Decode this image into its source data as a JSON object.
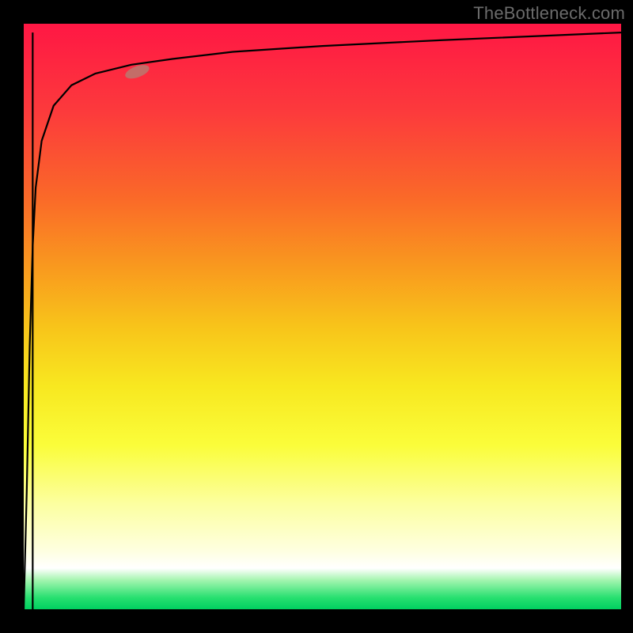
{
  "watermark": "TheBottleneck.com",
  "chart_data": {
    "type": "line",
    "title": "",
    "xlabel": "",
    "ylabel": "",
    "xlim": [
      0,
      1
    ],
    "ylim": [
      0,
      1
    ],
    "x": [
      0.0,
      0.005,
      0.01,
      0.015,
      0.02,
      0.03,
      0.05,
      0.08,
      0.12,
      0.18,
      0.25,
      0.35,
      0.5,
      0.7,
      1.0
    ],
    "values": [
      0.0,
      0.2,
      0.45,
      0.62,
      0.72,
      0.8,
      0.86,
      0.895,
      0.915,
      0.93,
      0.94,
      0.952,
      0.962,
      0.972,
      0.985
    ],
    "marker": {
      "x": 0.19,
      "y": 0.918
    },
    "spike": {
      "x": 0.015,
      "y0": 0.0,
      "y1": 0.985
    },
    "background_gradient": [
      "#ff1744",
      "#f99b1e",
      "#f8e820",
      "#ffffff",
      "#00d060"
    ],
    "axes_visible": false,
    "grid": false
  }
}
